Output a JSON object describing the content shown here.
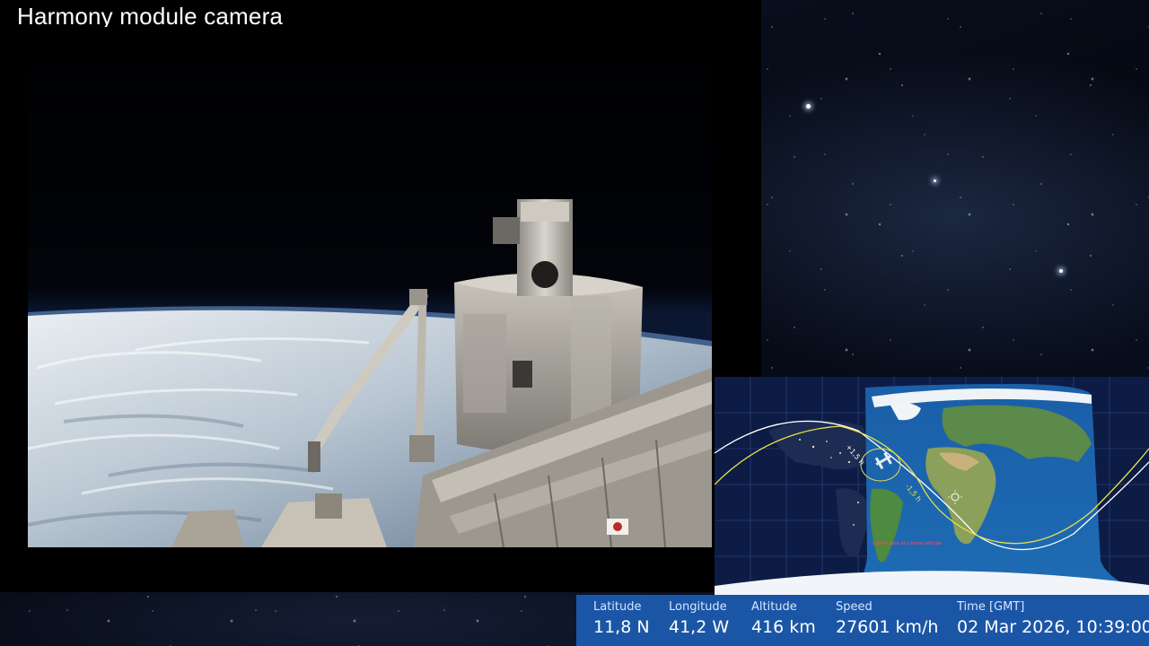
{
  "camera": {
    "title": "Harmony module camera"
  },
  "map": {
    "track_label_ahead": "+1,5 h",
    "track_label_behind": "-1,5 h",
    "footnote": "Orbital path at current altitude"
  },
  "telemetry": {
    "latitude": {
      "label": "Latitude",
      "value": "11,8 N"
    },
    "longitude": {
      "label": "Longitude",
      "value": "41,2 W"
    },
    "altitude": {
      "label": "Altitude",
      "value": "416 km"
    },
    "speed": {
      "label": "Speed",
      "value": "27601 km/h"
    },
    "time": {
      "label": "Time [GMT]",
      "value": "02 Mar 2026, 10:39:00"
    }
  },
  "colors": {
    "telemetry_bar": "#1b56a6",
    "orbit_ahead": "#ffffff",
    "orbit_behind": "#e8e04a"
  },
  "icons": [
    "iss-icon",
    "sun-icon"
  ]
}
